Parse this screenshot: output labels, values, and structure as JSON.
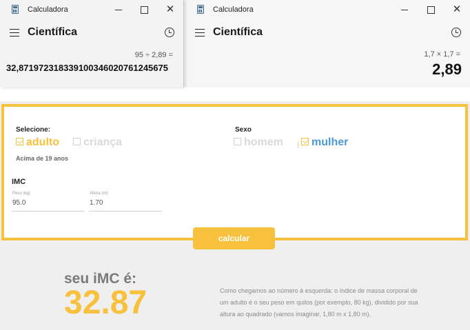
{
  "calc_left": {
    "window_title": "Calculadora",
    "mode": "Científica",
    "expression": "95 ÷ 2,89 =",
    "result": "32,871972318339100346020761245675"
  },
  "calc_right": {
    "window_title": "Calculadora",
    "mode": "Científica",
    "expression": "1,7 × 1,7 =",
    "result": "2,89"
  },
  "imc_form": {
    "select_label": "Selecione:",
    "age_options": [
      {
        "label": "adulto",
        "checked": true
      },
      {
        "label": "criança",
        "checked": false
      }
    ],
    "age_note": "Acima de 19 anos",
    "sex_label": "Sexo",
    "sex_options": [
      {
        "label": "homem",
        "checked": false
      },
      {
        "label": "mulher",
        "checked": true
      }
    ],
    "section_title": "IMC",
    "weight": {
      "label": "Peso (kg)",
      "value": "95.0"
    },
    "height": {
      "label": "Altura (m)",
      "value": "1.70"
    },
    "button_label": "calcular"
  },
  "imc_result": {
    "label": "seu iMC é:",
    "value": "32.87",
    "explanation": "Como chegamos ao número à esquerda: o índice de massa corporal de um adulto é o seu peso em quilos (por exemplo, 80 kg), dividido por sua altura ao quadrado (vamos imaginar, 1,80 m x 1,80 m)."
  },
  "colors": {
    "accent_yellow": "#f8c13d",
    "selected_blue": "#4a9ad8",
    "muted_gray": "#d9d9d9"
  },
  "icons": [
    "calculator-app-icon",
    "minimize-icon",
    "maximize-icon",
    "close-icon",
    "hamburger-menu-icon",
    "history-icon",
    "checkbox-icon"
  ]
}
